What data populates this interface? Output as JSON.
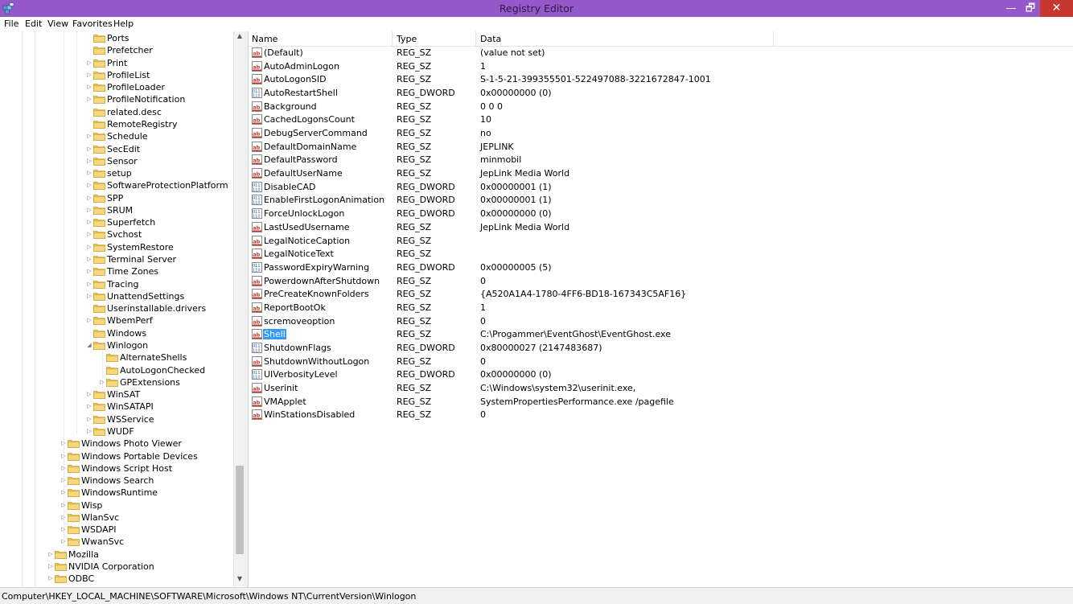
{
  "window": {
    "title": "Registry Editor",
    "close_glyph": "✕",
    "max_glyph": "🗗",
    "min_glyph": "—"
  },
  "menu": [
    "File",
    "Edit",
    "View",
    "Favorites",
    "Help"
  ],
  "tree": [
    {
      "label": "Ports",
      "depth": 3,
      "expander": "none"
    },
    {
      "label": "Prefetcher",
      "depth": 3,
      "expander": "none"
    },
    {
      "label": "Print",
      "depth": 3,
      "expander": "collapsed"
    },
    {
      "label": "ProfileList",
      "depth": 3,
      "expander": "collapsed"
    },
    {
      "label": "ProfileLoader",
      "depth": 3,
      "expander": "collapsed"
    },
    {
      "label": "ProfileNotification",
      "depth": 3,
      "expander": "collapsed"
    },
    {
      "label": "related.desc",
      "depth": 3,
      "expander": "none"
    },
    {
      "label": "RemoteRegistry",
      "depth": 3,
      "expander": "none"
    },
    {
      "label": "Schedule",
      "depth": 3,
      "expander": "collapsed"
    },
    {
      "label": "SecEdit",
      "depth": 3,
      "expander": "collapsed"
    },
    {
      "label": "Sensor",
      "depth": 3,
      "expander": "collapsed"
    },
    {
      "label": "setup",
      "depth": 3,
      "expander": "collapsed"
    },
    {
      "label": "SoftwareProtectionPlatform",
      "depth": 3,
      "expander": "collapsed"
    },
    {
      "label": "SPP",
      "depth": 3,
      "expander": "collapsed"
    },
    {
      "label": "SRUM",
      "depth": 3,
      "expander": "collapsed"
    },
    {
      "label": "Superfetch",
      "depth": 3,
      "expander": "collapsed"
    },
    {
      "label": "Svchost",
      "depth": 3,
      "expander": "collapsed"
    },
    {
      "label": "SystemRestore",
      "depth": 3,
      "expander": "collapsed"
    },
    {
      "label": "Terminal Server",
      "depth": 3,
      "expander": "collapsed"
    },
    {
      "label": "Time Zones",
      "depth": 3,
      "expander": "collapsed"
    },
    {
      "label": "Tracing",
      "depth": 3,
      "expander": "collapsed"
    },
    {
      "label": "UnattendSettings",
      "depth": 3,
      "expander": "collapsed"
    },
    {
      "label": "Userinstallable.drivers",
      "depth": 3,
      "expander": "none"
    },
    {
      "label": "WbemPerf",
      "depth": 3,
      "expander": "collapsed"
    },
    {
      "label": "Windows",
      "depth": 3,
      "expander": "none"
    },
    {
      "label": "Winlogon",
      "depth": 3,
      "expander": "expanded"
    },
    {
      "label": "AlternateShells",
      "depth": 4,
      "expander": "none"
    },
    {
      "label": "AutoLogonChecked",
      "depth": 4,
      "expander": "none"
    },
    {
      "label": "GPExtensions",
      "depth": 4,
      "expander": "collapsed"
    },
    {
      "label": "WinSAT",
      "depth": 3,
      "expander": "collapsed"
    },
    {
      "label": "WinSATAPI",
      "depth": 3,
      "expander": "collapsed"
    },
    {
      "label": "WSService",
      "depth": 3,
      "expander": "collapsed"
    },
    {
      "label": "WUDF",
      "depth": 3,
      "expander": "collapsed"
    },
    {
      "label": "Windows Photo Viewer",
      "depth": 1,
      "expander": "collapsed"
    },
    {
      "label": "Windows Portable Devices",
      "depth": 1,
      "expander": "collapsed"
    },
    {
      "label": "Windows Script Host",
      "depth": 1,
      "expander": "collapsed"
    },
    {
      "label": "Windows Search",
      "depth": 1,
      "expander": "collapsed"
    },
    {
      "label": "WindowsRuntime",
      "depth": 1,
      "expander": "collapsed"
    },
    {
      "label": "Wisp",
      "depth": 1,
      "expander": "collapsed"
    },
    {
      "label": "WlanSvc",
      "depth": 1,
      "expander": "collapsed"
    },
    {
      "label": "WSDAPI",
      "depth": 1,
      "expander": "collapsed"
    },
    {
      "label": "WwanSvc",
      "depth": 1,
      "expander": "collapsed"
    },
    {
      "label": "Mozilla",
      "depth": 0,
      "expander": "collapsed"
    },
    {
      "label": "NVIDIA Corporation",
      "depth": 0,
      "expander": "collapsed"
    },
    {
      "label": "ODBC",
      "depth": 0,
      "expander": "collapsed"
    }
  ],
  "list": {
    "columns": [
      "Name",
      "Type",
      "Data"
    ],
    "rows": [
      {
        "name": "(Default)",
        "type": "REG_SZ",
        "data": "(value not set)",
        "icon": "string-value-icon"
      },
      {
        "name": "AutoAdminLogon",
        "type": "REG_SZ",
        "data": "1",
        "icon": "string-value-icon"
      },
      {
        "name": "AutoLogonSID",
        "type": "REG_SZ",
        "data": "S-1-5-21-399355501-522497088-3221672847-1001",
        "icon": "string-value-icon"
      },
      {
        "name": "AutoRestartShell",
        "type": "REG_DWORD",
        "data": "0x00000000 (0)",
        "icon": "binary-value-icon"
      },
      {
        "name": "Background",
        "type": "REG_SZ",
        "data": "0 0 0",
        "icon": "string-value-icon"
      },
      {
        "name": "CachedLogonsCount",
        "type": "REG_SZ",
        "data": "10",
        "icon": "string-value-icon"
      },
      {
        "name": "DebugServerCommand",
        "type": "REG_SZ",
        "data": "no",
        "icon": "string-value-icon"
      },
      {
        "name": "DefaultDomainName",
        "type": "REG_SZ",
        "data": "JEPLINK",
        "icon": "string-value-icon"
      },
      {
        "name": "DefaultPassword",
        "type": "REG_SZ",
        "data": "minmobil",
        "icon": "string-value-icon"
      },
      {
        "name": "DefaultUserName",
        "type": "REG_SZ",
        "data": "JepLink Media World",
        "icon": "string-value-icon"
      },
      {
        "name": "DisableCAD",
        "type": "REG_DWORD",
        "data": "0x00000001 (1)",
        "icon": "binary-value-icon"
      },
      {
        "name": "EnableFirstLogonAnimation",
        "type": "REG_DWORD",
        "data": "0x00000001 (1)",
        "icon": "binary-value-icon"
      },
      {
        "name": "ForceUnlockLogon",
        "type": "REG_DWORD",
        "data": "0x00000000 (0)",
        "icon": "binary-value-icon"
      },
      {
        "name": "LastUsedUsername",
        "type": "REG_SZ",
        "data": "JepLink Media World",
        "icon": "string-value-icon"
      },
      {
        "name": "LegalNoticeCaption",
        "type": "REG_SZ",
        "data": "",
        "icon": "string-value-icon"
      },
      {
        "name": "LegalNoticeText",
        "type": "REG_SZ",
        "data": "",
        "icon": "string-value-icon"
      },
      {
        "name": "PasswordExpiryWarning",
        "type": "REG_DWORD",
        "data": "0x00000005 (5)",
        "icon": "binary-value-icon"
      },
      {
        "name": "PowerdownAfterShutdown",
        "type": "REG_SZ",
        "data": "0",
        "icon": "string-value-icon"
      },
      {
        "name": "PreCreateKnownFolders",
        "type": "REG_SZ",
        "data": "{A520A1A4-1780-4FF6-BD18-167343C5AF16}",
        "icon": "string-value-icon"
      },
      {
        "name": "ReportBootOk",
        "type": "REG_SZ",
        "data": "1",
        "icon": "string-value-icon"
      },
      {
        "name": "scremoveoption",
        "type": "REG_SZ",
        "data": "0",
        "icon": "string-value-icon"
      },
      {
        "name": "Shell",
        "type": "REG_SZ",
        "data": "C:\\Progammer\\EventGhost\\EventGhost.exe",
        "icon": "string-value-icon",
        "selected": true
      },
      {
        "name": "ShutdownFlags",
        "type": "REG_DWORD",
        "data": "0x80000027 (2147483687)",
        "icon": "binary-value-icon"
      },
      {
        "name": "ShutdownWithoutLogon",
        "type": "REG_SZ",
        "data": "0",
        "icon": "string-value-icon"
      },
      {
        "name": "UIVerbosityLevel",
        "type": "REG_DWORD",
        "data": "0x00000000 (0)",
        "icon": "binary-value-icon"
      },
      {
        "name": "Userinit",
        "type": "REG_SZ",
        "data": "C:\\Windows\\system32\\userinit.exe,",
        "icon": "string-value-icon"
      },
      {
        "name": "VMApplet",
        "type": "REG_SZ",
        "data": "SystemPropertiesPerformance.exe /pagefile",
        "icon": "string-value-icon"
      },
      {
        "name": "WinStationsDisabled",
        "type": "REG_SZ",
        "data": "0",
        "icon": "string-value-icon"
      }
    ]
  },
  "status": {
    "path": "Computer\\HKEY_LOCAL_MACHINE\\SOFTWARE\\Microsoft\\Windows NT\\CurrentVersion\\Winlogon"
  },
  "colors": {
    "titlebar": "#9458c9",
    "close_button": "#c7372f",
    "selection": "#3399ff",
    "folder": "#f0c85a"
  }
}
